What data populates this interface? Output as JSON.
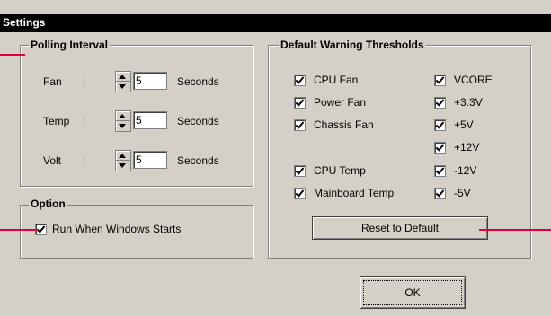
{
  "window": {
    "title": "Settings"
  },
  "polling": {
    "legend": "Polling Interval",
    "rows": [
      {
        "label": "Fan",
        "colon": ":",
        "value": "5",
        "unit": "Seconds"
      },
      {
        "label": "Temp",
        "colon": ":",
        "value": "5",
        "unit": "Seconds"
      },
      {
        "label": "Volt",
        "colon": ":",
        "value": "5",
        "unit": "Seconds"
      }
    ]
  },
  "option": {
    "legend": "Option",
    "run_label": "Run When Windows Starts",
    "run_checked": true
  },
  "thresholds": {
    "legend": "Default Warning Thresholds",
    "left": [
      "CPU Fan",
      "Power Fan",
      "Chassis Fan",
      "CPU Temp",
      "Mainboard Temp"
    ],
    "right": [
      "VCORE",
      "+3.3V",
      "+5V",
      "+12V",
      "-12V",
      "-5V"
    ],
    "reset_label": "Reset to Default"
  },
  "ok_label": "OK",
  "colors": {
    "accent_line": "#e0003a",
    "titlebar": "#000000",
    "face": "#d4d0c8"
  }
}
